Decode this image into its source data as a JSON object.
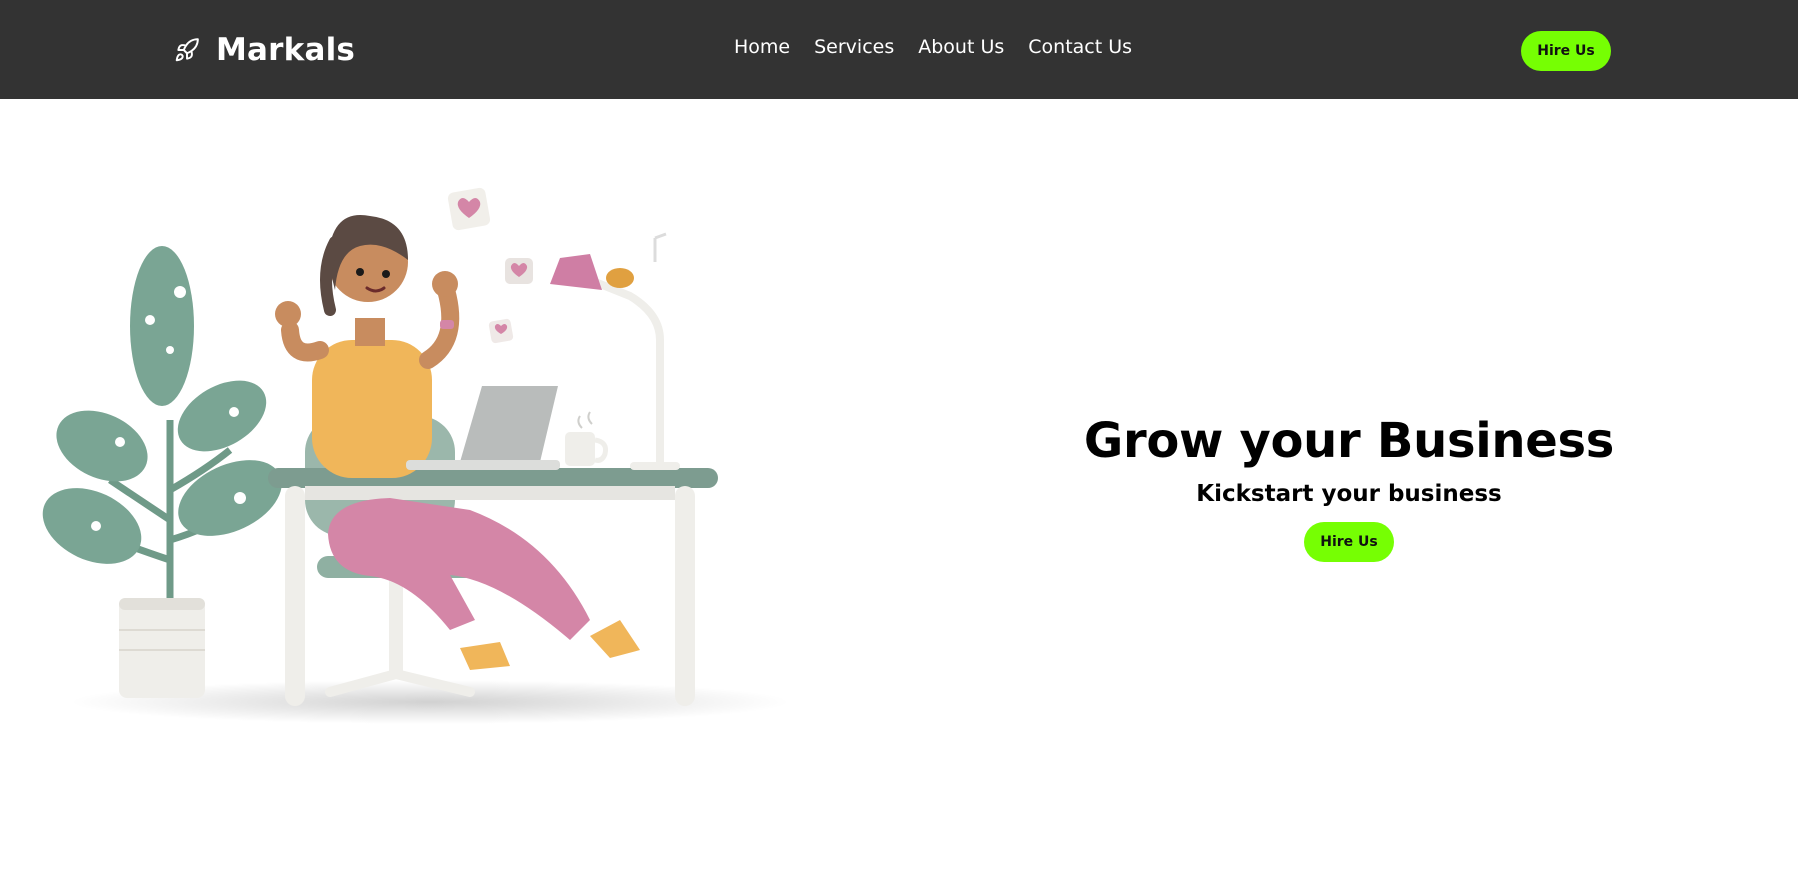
{
  "nav": {
    "brand": "Markals",
    "brand_icon": "rocket-icon",
    "links": [
      "Home",
      "Services",
      "About Us",
      "Contact Us"
    ],
    "cta": "Hire Us"
  },
  "hero": {
    "title": "Grow your Business",
    "subtitle": "Kickstart your business",
    "cta": "Hire Us",
    "illustration": "woman-at-desk-with-laptop"
  },
  "colors": {
    "navbar": "#333333",
    "accent": "#76ff03",
    "text": "#000000",
    "nav_text": "#ffffff"
  }
}
